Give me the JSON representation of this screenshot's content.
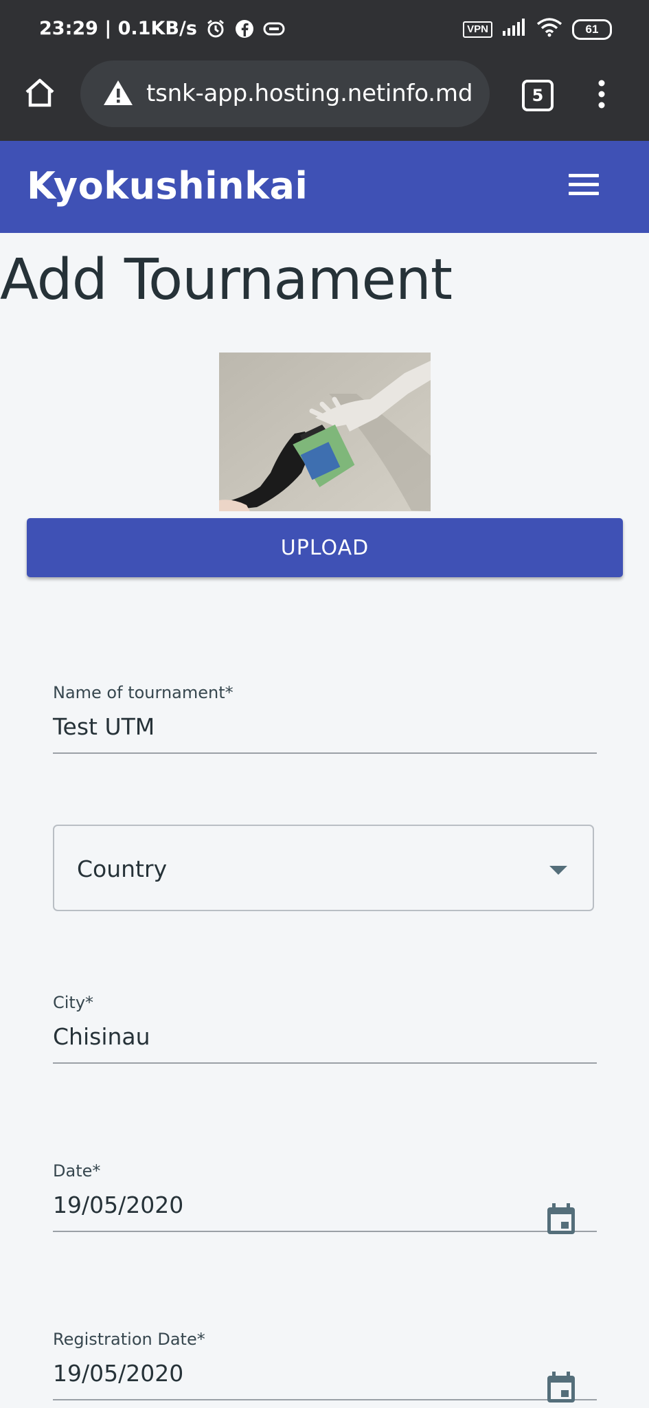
{
  "status_bar": {
    "time": "23:29",
    "network_speed": "0.1KB/s",
    "vpn_label": "VPN",
    "battery": "61"
  },
  "browser": {
    "url": "tsnk-app.hosting.netinfo.md",
    "tab_count": "5"
  },
  "app": {
    "title": "Kyokushinkai"
  },
  "page": {
    "title": "Add Tournament",
    "upload_label": "UPLOAD"
  },
  "form": {
    "name": {
      "label": "Name of tournament*",
      "value": "Test UTM"
    },
    "country": {
      "label": "Country"
    },
    "city": {
      "label": "City*",
      "value": "Chisinau"
    },
    "date": {
      "label": "Date*",
      "value": "19/05/2020"
    },
    "registration_date": {
      "label": "Registration Date*",
      "value": "19/05/2020"
    }
  },
  "colors": {
    "primary": "#3f51b5",
    "browser_chrome": "#303134",
    "page_background": "#f4f6f8"
  }
}
